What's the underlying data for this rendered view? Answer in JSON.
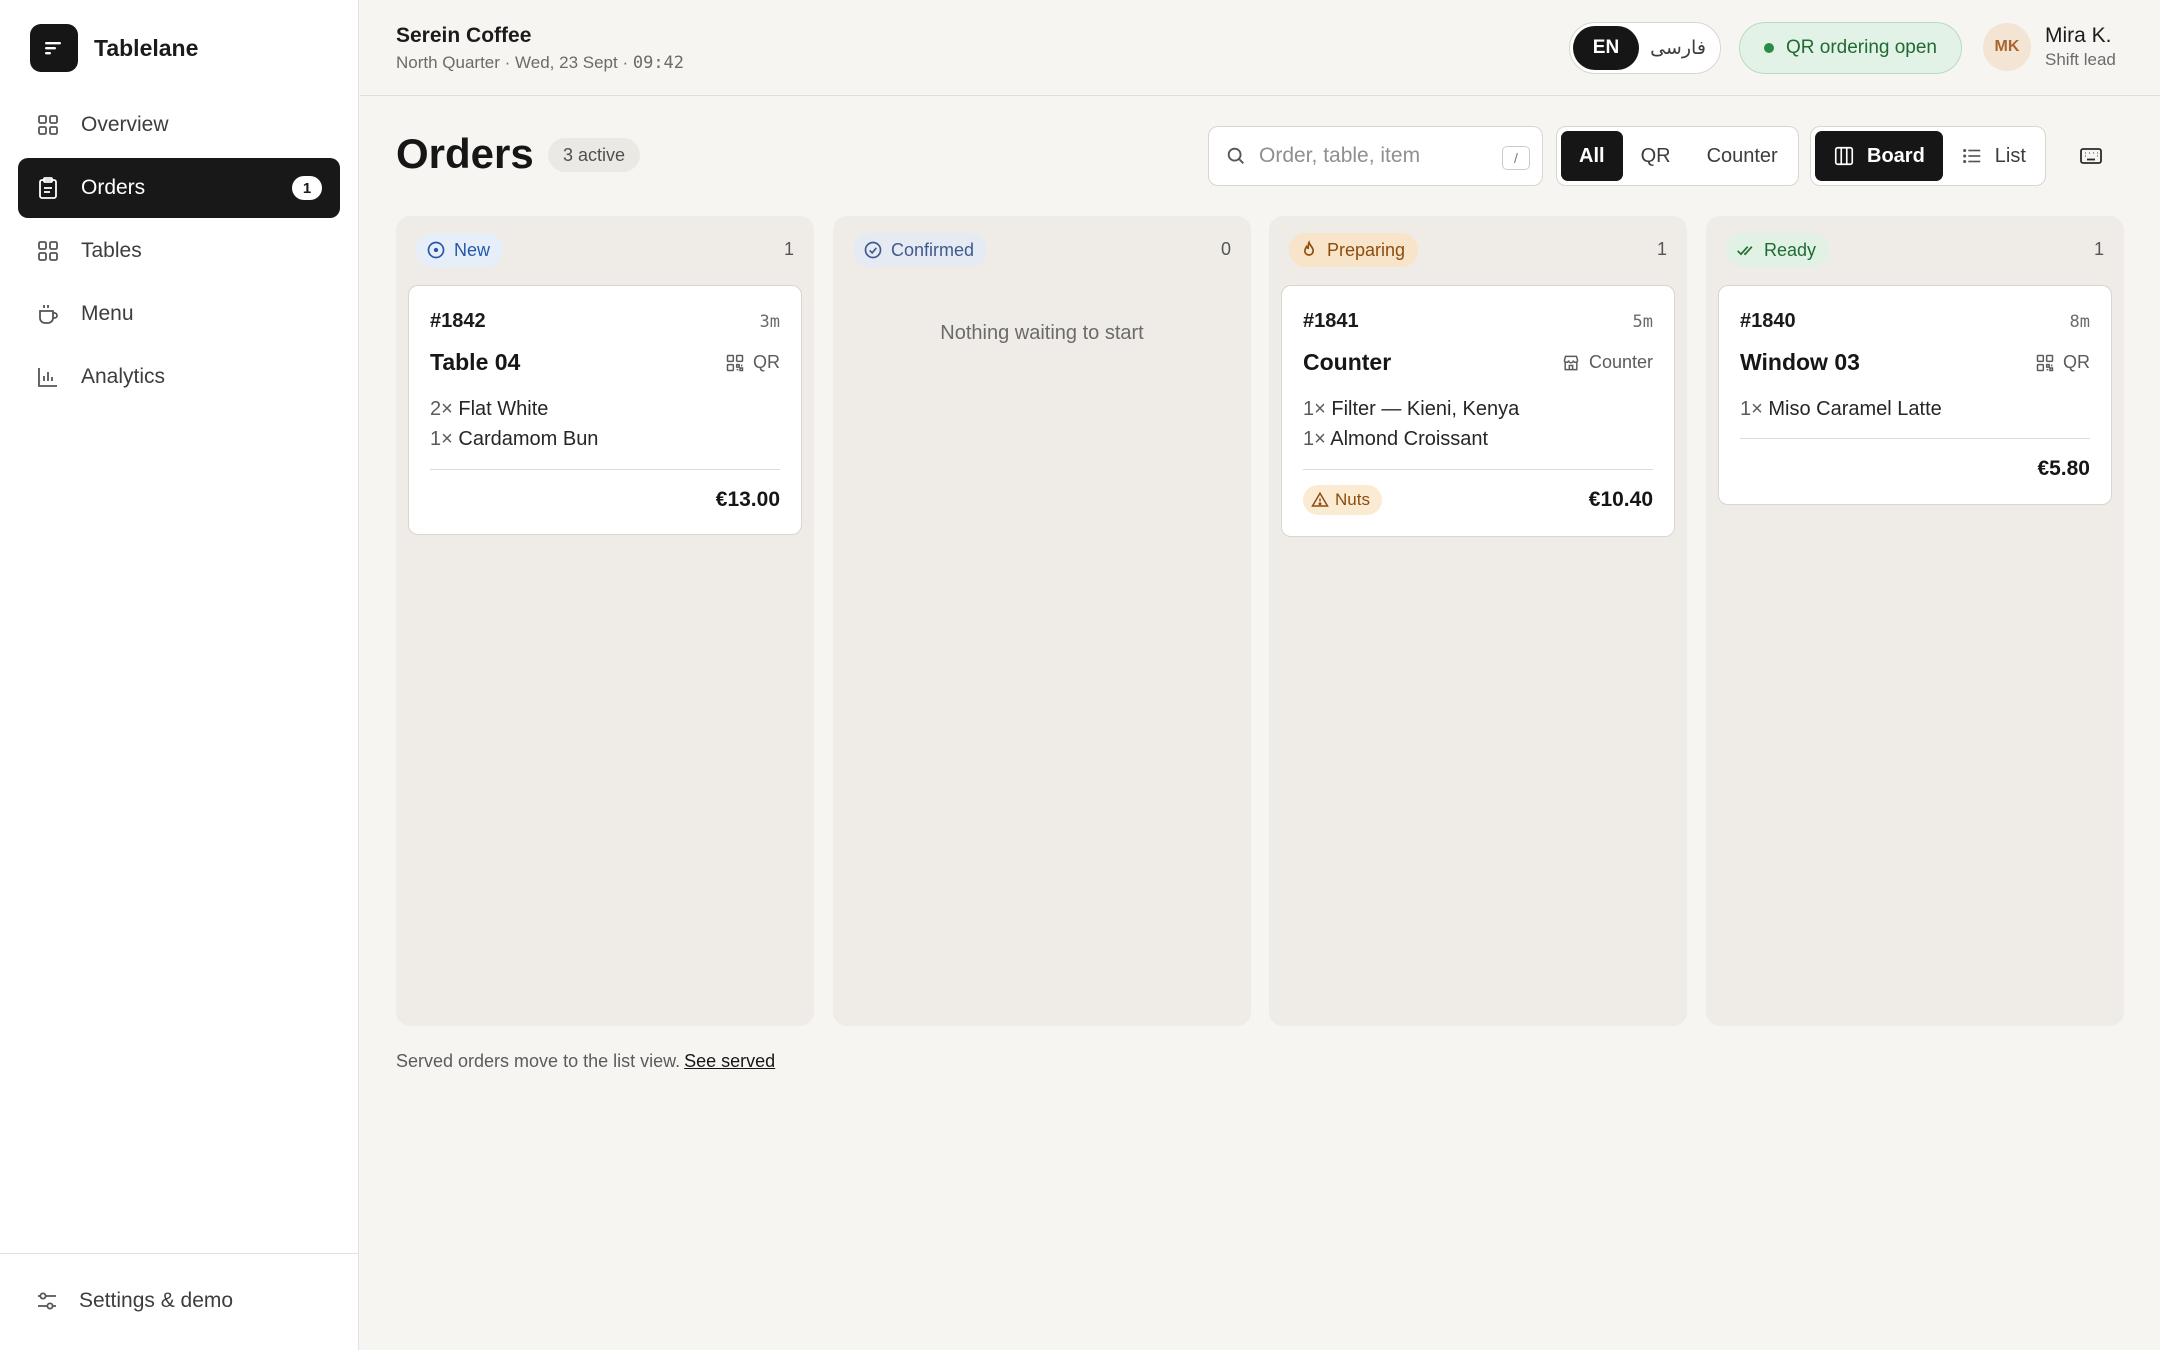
{
  "brand": {
    "name": "Tablelane"
  },
  "nav": [
    {
      "label": "Overview",
      "icon": "grid-icon",
      "active": false
    },
    {
      "label": "Orders",
      "icon": "clipboard-icon",
      "active": true,
      "badge": "1"
    },
    {
      "label": "Tables",
      "icon": "grid-icon",
      "active": false
    },
    {
      "label": "Menu",
      "icon": "coffee-cup-icon",
      "active": false
    },
    {
      "label": "Analytics",
      "icon": "bar-chart-icon",
      "active": false
    }
  ],
  "settings": {
    "label": "Settings & demo",
    "icon": "sliders-icon"
  },
  "venue": {
    "name": "Serein Coffee",
    "subtitle_prefix": "North Quarter · Wed, 23 Sept · ",
    "time": "09:42"
  },
  "language": {
    "active": "EN",
    "other": "فارسی"
  },
  "qr_status": {
    "label": "QR ordering open",
    "color": "#2e8a47"
  },
  "user": {
    "initials": "MK",
    "name": "Mira K.",
    "role": "Shift lead"
  },
  "page": {
    "title": "Orders",
    "active_count": "3 active"
  },
  "search": {
    "placeholder": "Order, table, item",
    "value": "",
    "shortcut": "/"
  },
  "source_filter": {
    "options": [
      "All",
      "QR",
      "Counter"
    ],
    "selected": "All"
  },
  "view_toggle": {
    "options": [
      "Board",
      "List"
    ],
    "selected": "Board"
  },
  "columns": [
    {
      "status": "New",
      "count": "1",
      "color": "#2559a8",
      "cards": [
        {
          "id": "#1842",
          "age": "3m",
          "title": "Table 04",
          "source": "QR",
          "source_icon": "qr-code-icon",
          "items": [
            {
              "qty": "2×",
              "name": "Flat White"
            },
            {
              "qty": "1×",
              "name": "Cardamom Bun"
            }
          ],
          "total": "€13.00",
          "allergen": null
        }
      ]
    },
    {
      "status": "Confirmed",
      "count": "0",
      "color": "#3f5a8c",
      "empty_text": "Nothing waiting to start",
      "cards": []
    },
    {
      "status": "Preparing",
      "count": "1",
      "color": "#8b4c10",
      "cards": [
        {
          "id": "#1841",
          "age": "5m",
          "title": "Counter",
          "source": "Counter",
          "source_icon": "store-icon",
          "items": [
            {
              "qty": "1×",
              "name": "Filter — Kieni, Kenya"
            },
            {
              "qty": "1×",
              "name": "Almond Croissant"
            }
          ],
          "total": "€10.40",
          "allergen": "Nuts"
        }
      ]
    },
    {
      "status": "Ready",
      "count": "1",
      "color": "#1f6b33",
      "cards": [
        {
          "id": "#1840",
          "age": "8m",
          "title": "Window 03",
          "source": "QR",
          "source_icon": "qr-code-icon",
          "items": [
            {
              "qty": "1×",
              "name": "Miso Caramel Latte"
            }
          ],
          "total": "€5.80",
          "allergen": null
        }
      ]
    }
  ],
  "footnote": {
    "text": "Served orders move to the list view.",
    "link": "See served"
  }
}
